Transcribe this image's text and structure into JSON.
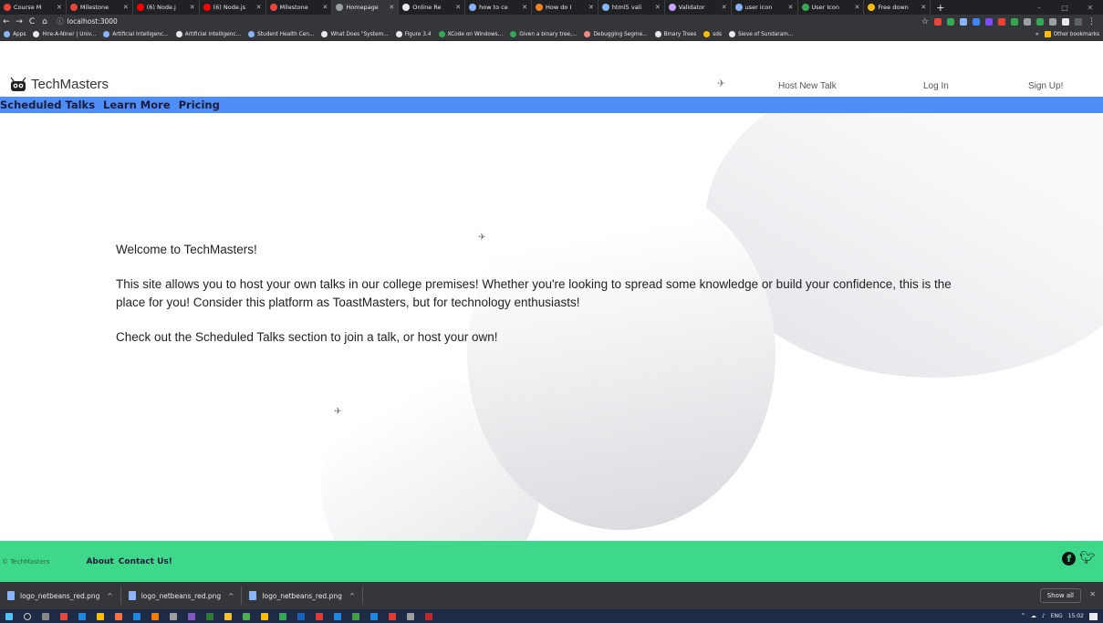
{
  "browser": {
    "tabs": [
      {
        "label": "Course M",
        "color": "#e8453c"
      },
      {
        "label": "Milestone",
        "color": "#e8453c"
      },
      {
        "label": "(6) Node.j",
        "color": "#ff0000"
      },
      {
        "label": "(6) Node.js",
        "color": "#ff0000"
      },
      {
        "label": "Milestone",
        "color": "#e8453c"
      },
      {
        "label": "Homepage",
        "color": "#9aa0a6",
        "active": true
      },
      {
        "label": "Online Re",
        "color": "#e8eaed"
      },
      {
        "label": "how to ce",
        "color": "#8ab4f8"
      },
      {
        "label": "How do I",
        "color": "#f48024"
      },
      {
        "label": "html5 vali",
        "color": "#8ab4f8"
      },
      {
        "label": "Validator",
        "color": "#c8a2ff"
      },
      {
        "label": "user icon",
        "color": "#8ab4f8"
      },
      {
        "label": "User Icon",
        "color": "#34a853"
      },
      {
        "label": "Free down",
        "color": "#fbbc04"
      }
    ],
    "new_tab": "+",
    "url": "localhost:3000",
    "bookmarks": [
      {
        "label": "Apps",
        "color": "#8ab4f8"
      },
      {
        "label": "Hire-A-Niner | Univ...",
        "color": "#e8eaed"
      },
      {
        "label": "Artificial Intelligenc...",
        "color": "#8ab4f8"
      },
      {
        "label": "Artificial Intelligenc...",
        "color": "#e8eaed"
      },
      {
        "label": "Student Health Cen...",
        "color": "#8ab4f8"
      },
      {
        "label": "What Does \"System...",
        "color": "#e8eaed"
      },
      {
        "label": "Figure 3.4",
        "color": "#e8eaed"
      },
      {
        "label": "XCode on Windows...",
        "color": "#34a853"
      },
      {
        "label": "Given a binary tree,...",
        "color": "#34a853"
      },
      {
        "label": "Debugging Segme...",
        "color": "#f28b82"
      },
      {
        "label": "Binary Trees",
        "color": "#e8eaed"
      },
      {
        "label": "sds",
        "color": "#fbbc04"
      },
      {
        "label": "Sieve of Sundaram...",
        "color": "#e8eaed"
      }
    ],
    "bookmarks_more": "»",
    "other_bookmarks": "Other bookmarks"
  },
  "site": {
    "brand": "TechMasters",
    "header_nav": {
      "host": "Host New Talk",
      "login": "Log In",
      "signup": "Sign Up!"
    },
    "subnav": [
      "Scheduled Talks",
      "Learn More",
      "Pricing"
    ],
    "content": {
      "welcome": "Welcome to TechMasters!",
      "para1": "This site allows you to host your own talks in our college premises! Whether you're looking to spread some knowledge or build your confidence, this is the place for you! Consider this platform as ToastMasters, but for technology enthusiasts!",
      "para2": "Check out the Scheduled Talks section to join a talk, or host your own!"
    },
    "footer": {
      "copyright": "© TechMasters",
      "about": "About",
      "contact": "Contact Us!"
    },
    "colors": {
      "subnav_bg": "#4f8ef7",
      "footer_bg": "#3ed88a"
    }
  },
  "downloads": {
    "items": [
      "logo_netbeans_red.png",
      "logo_netbeans_red.png",
      "logo_netbeans_red.png"
    ],
    "show_all": "Show all"
  },
  "taskbar": {
    "lang": "ENG",
    "time": "15:02"
  }
}
